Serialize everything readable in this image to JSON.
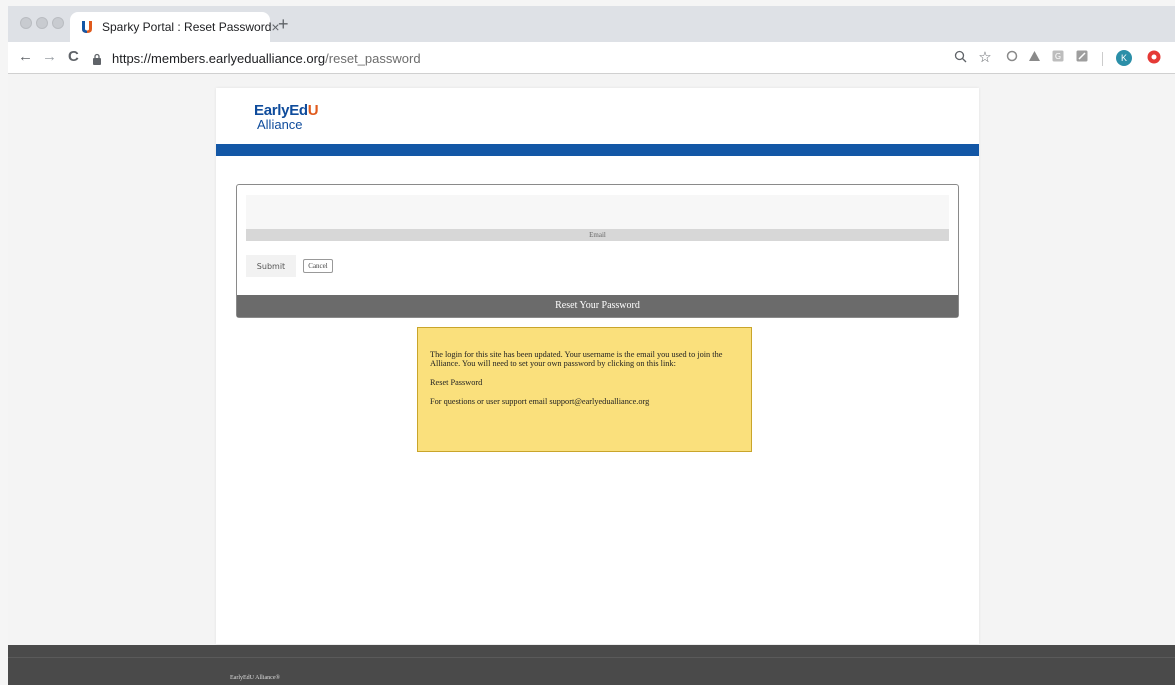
{
  "browser": {
    "tab_title": "Sparky Portal : Reset Password",
    "tab_close": "×",
    "new_tab": "+",
    "url_host": "https://members.earlyedualliance.org",
    "url_path": "/reset_password",
    "back": "←",
    "forward": "→",
    "reload": "C",
    "profile_initial": "K"
  },
  "logo": {
    "line1_prefix": "EarlyEd",
    "line1_u": "U",
    "line2": "Alliance"
  },
  "form": {
    "email_label": "Email",
    "email_value": "",
    "submit_label": "Submit",
    "cancel_label": "Cancel",
    "footer_title": "Reset Your Password"
  },
  "notice": {
    "message": "The login for this site has been updated. Your username is the email you used to join the Alliance. You will need to set your own password by clicking on this link:",
    "link_label": "Reset Password",
    "support": "For questions or user support email support@earlyedualliance.org"
  },
  "footer": {
    "text": "EarlyEdU Alliance®"
  },
  "colors": {
    "brand_blue": "#1357a6",
    "brand_orange": "#e05a1c",
    "notice_bg": "#fae07c",
    "footer_bg": "#4a4a4a"
  }
}
